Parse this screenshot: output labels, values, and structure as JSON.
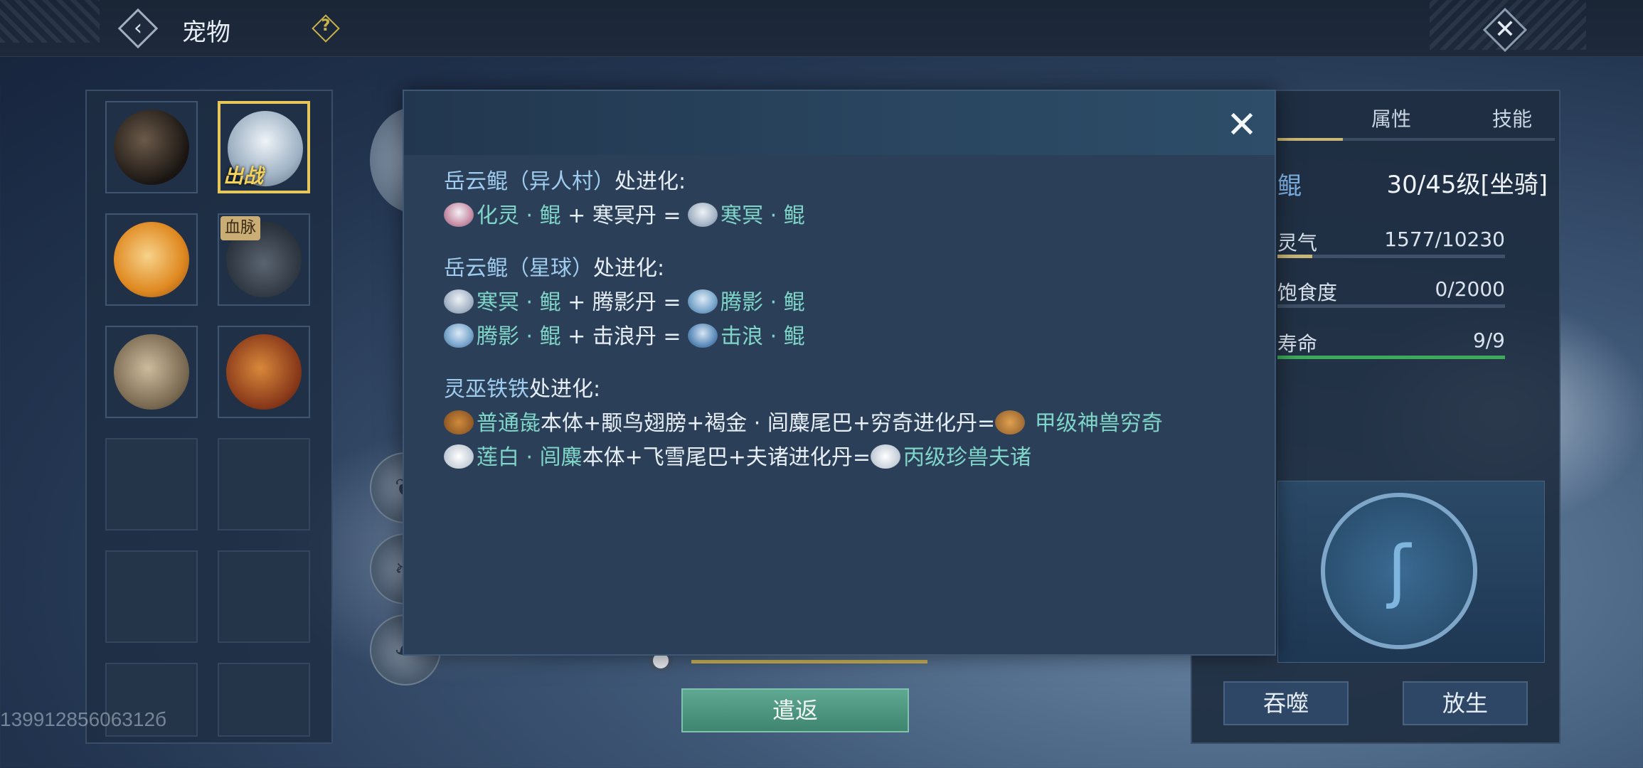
{
  "header": {
    "title": "宠物",
    "back_icon": "back-chevron-icon",
    "help_icon": "question-mark-icon",
    "close_icon": "close-x-icon"
  },
  "pet_list": {
    "slots": [
      {
        "state": "filled",
        "portrait": "black-horse"
      },
      {
        "state": "filled",
        "portrait": "pale-kun-fish",
        "selected": true,
        "badge": "出战"
      },
      {
        "state": "filled",
        "portrait": "orange-fox"
      },
      {
        "state": "filled",
        "portrait": "dark-fish",
        "badge": "血脉"
      },
      {
        "state": "filled",
        "portrait": "horned-beast"
      },
      {
        "state": "filled",
        "portrait": "red-eagle"
      },
      {
        "state": "empty"
      },
      {
        "state": "empty"
      },
      {
        "state": "empty"
      },
      {
        "state": "empty"
      },
      {
        "state": "empty"
      },
      {
        "state": "empty"
      }
    ],
    "out_badge": "出战",
    "blood_badge": "血脉"
  },
  "user_id": "13991285606312б",
  "dismiss_button": "遣返",
  "info_panel": {
    "tabs": [
      "属性",
      "技能"
    ],
    "pet_name": "鲲",
    "level": "30/45级[坐骑]",
    "stats": [
      {
        "label": "灵气",
        "value": "1577/10230",
        "fill": 0.154,
        "color": "#c9b778"
      },
      {
        "label": "饱食度",
        "value": "0/2000",
        "fill": 0.0,
        "color": "#c9b778"
      },
      {
        "label": "寿命",
        "value": "9/9",
        "fill": 1.0,
        "color": "#3daa5a"
      }
    ],
    "devour_button": "吞噬",
    "release_button": "放生"
  },
  "modal": {
    "close_icon": "close-x-icon",
    "sections": [
      {
        "title_hl": "岳云鲲（异人村）",
        "title_tail": "处进化:",
        "rows": [
          {
            "a_icon": "fish",
            "a": "化灵 · 鲲",
            "op": " + 寒冥丹 = ",
            "b_icon": "fish2",
            "b": "寒冥 · 鲲"
          }
        ]
      },
      {
        "title_hl": "岳云鲲（星球）",
        "title_tail": "处进化:",
        "rows": [
          {
            "a_icon": "fish2",
            "a": "寒冥 · 鲲",
            "op": " + 腾影丹 = ",
            "b_icon": "fish3",
            "b": "腾影 · 鲲"
          },
          {
            "a_icon": "fish3",
            "a": "腾影 · 鲲",
            "op": " + 击浪丹 = ",
            "b_icon": "fish4",
            "b": "击浪 · 鲲"
          }
        ]
      },
      {
        "title_hl": "灵巫铁铁",
        "title_tail": "处进化:",
        "rows": [
          {
            "a_icon": "beast",
            "a": "普通彘",
            "op": "本体+颙鸟翅膀+褐金 · 闾麋尾巴+穷奇进化丹=",
            "b_icon": "beast2",
            "b": " 甲级神兽穷奇"
          },
          {
            "a_icon": "white",
            "a": "莲白 · 闾麋",
            "op": "本体+飞雪尾巴+夫诸进化丹=",
            "b_icon": "white",
            "b": "丙级珍兽夫诸"
          }
        ]
      }
    ]
  }
}
